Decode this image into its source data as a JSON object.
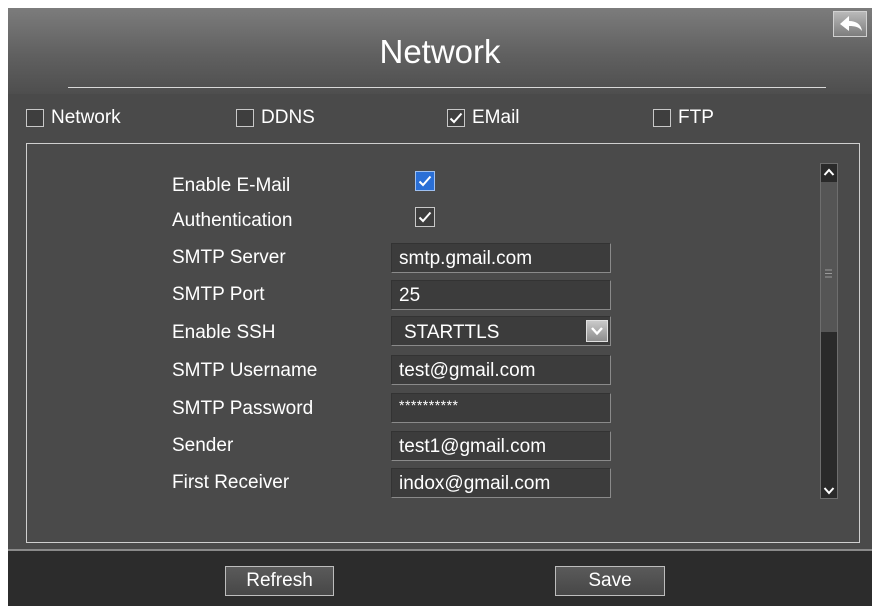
{
  "window": {
    "title": "Network"
  },
  "tabs": [
    {
      "label": "Network",
      "checked": false
    },
    {
      "label": "DDNS",
      "checked": false
    },
    {
      "label": "EMail",
      "checked": true
    },
    {
      "label": "FTP",
      "checked": false
    }
  ],
  "form": {
    "enable_email": {
      "label": "Enable E-Mail",
      "checked": true
    },
    "authentication": {
      "label": "Authentication",
      "checked": true
    },
    "smtp_server": {
      "label": "SMTP Server",
      "value": "smtp.gmail.com"
    },
    "smtp_port": {
      "label": "SMTP Port",
      "value": "25"
    },
    "enable_ssh": {
      "label": "Enable SSH",
      "value": "STARTTLS"
    },
    "smtp_username": {
      "label": "SMTP Username",
      "value": "test@gmail.com"
    },
    "smtp_password": {
      "label": "SMTP Password",
      "value": "**********"
    },
    "sender": {
      "label": "Sender",
      "value": "test1@gmail.com"
    },
    "first_receiver": {
      "label": "First Receiver",
      "value": "indox@gmail.com"
    }
  },
  "footer": {
    "refresh_label": "Refresh",
    "save_label": "Save"
  },
  "icons": {
    "back": "back-arrow-icon",
    "check": "checkmark-icon",
    "dropdown": "chevron-down-icon"
  },
  "colors": {
    "background": "#4a4a4a",
    "checkbox_accent": "#2a6fd6",
    "text": "#ffffff"
  }
}
